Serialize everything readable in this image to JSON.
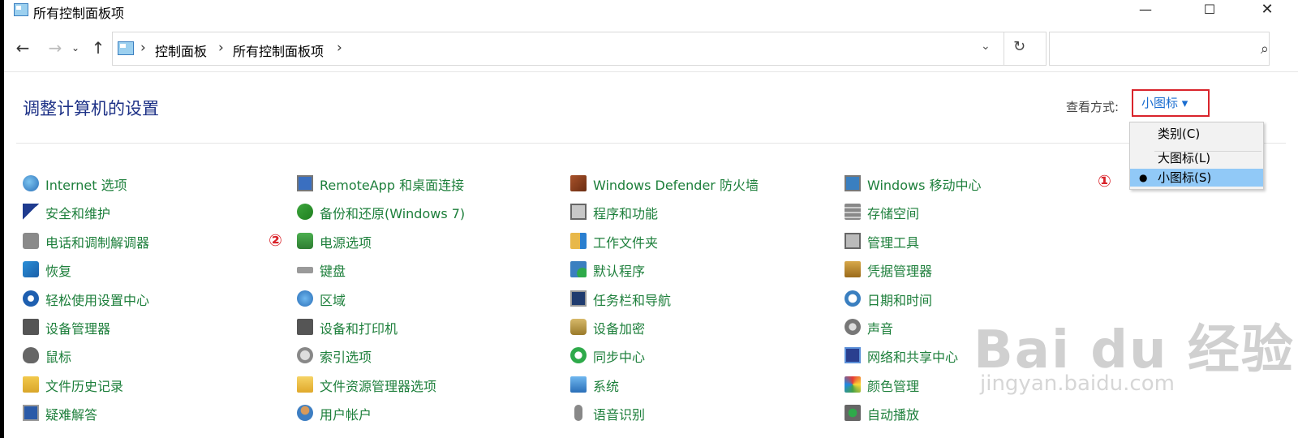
{
  "window": {
    "title": "所有控制面板项",
    "minimize": "—",
    "maximize": "☐",
    "close": "✕"
  },
  "nav": {
    "back": "←",
    "forward": "→",
    "recent": "⌄",
    "up": "↑",
    "refresh": "↻",
    "dropdown": "⌄",
    "crumbs": [
      "控制面板",
      "所有控制面板项"
    ],
    "separator": "›",
    "search_value": "",
    "search_icon": "⌕"
  },
  "header": {
    "title": "调整计算机的设置",
    "viewby_label": "查看方式:",
    "viewby_value": "小图标 ▾"
  },
  "view_menu": {
    "items": [
      "类别(C)",
      "大图标(L)",
      "小图标(S)"
    ],
    "selected_marker": "●"
  },
  "annotations": [
    "①",
    "②"
  ],
  "colors": {
    "link_green": "#1d7f3b",
    "title_blue": "#1e3287",
    "accent_red": "#d9242b",
    "menu_highlight": "#91c9f7"
  },
  "columns": [
    [
      {
        "label": "Internet 选项",
        "icon": "globe-icon"
      },
      {
        "label": "安全和维护",
        "icon": "flag-icon"
      },
      {
        "label": "电话和调制解调器",
        "icon": "fax-icon"
      },
      {
        "label": "恢复",
        "icon": "recovery-icon"
      },
      {
        "label": "轻松使用设置中心",
        "icon": "ease-of-access-icon"
      },
      {
        "label": "设备管理器",
        "icon": "device-manager-icon"
      },
      {
        "label": "鼠标",
        "icon": "mouse-icon"
      },
      {
        "label": "文件历史记录",
        "icon": "file-history-icon"
      },
      {
        "label": "疑难解答",
        "icon": "troubleshoot-icon"
      }
    ],
    [
      {
        "label": "RemoteApp 和桌面连接",
        "icon": "remote-desktop-icon"
      },
      {
        "label": "备份和还原(Windows 7)",
        "icon": "backup-icon"
      },
      {
        "label": "电源选项",
        "icon": "power-icon"
      },
      {
        "label": "键盘",
        "icon": "keyboard-icon"
      },
      {
        "label": "区域",
        "icon": "region-icon"
      },
      {
        "label": "设备和打印机",
        "icon": "printer-icon"
      },
      {
        "label": "索引选项",
        "icon": "index-icon"
      },
      {
        "label": "文件资源管理器选项",
        "icon": "folder-options-icon"
      },
      {
        "label": "用户帐户",
        "icon": "user-accounts-icon"
      }
    ],
    [
      {
        "label": "Windows Defender 防火墙",
        "icon": "firewall-icon"
      },
      {
        "label": "程序和功能",
        "icon": "programs-icon"
      },
      {
        "label": "工作文件夹",
        "icon": "work-folders-icon"
      },
      {
        "label": "默认程序",
        "icon": "default-programs-icon"
      },
      {
        "label": "任务栏和导航",
        "icon": "taskbar-icon"
      },
      {
        "label": "设备加密",
        "icon": "encryption-icon"
      },
      {
        "label": "同步中心",
        "icon": "sync-icon"
      },
      {
        "label": "系统",
        "icon": "system-icon"
      },
      {
        "label": "语音识别",
        "icon": "microphone-icon"
      }
    ],
    [
      {
        "label": "Windows 移动中心",
        "icon": "mobility-center-icon"
      },
      {
        "label": "存储空间",
        "icon": "storage-icon"
      },
      {
        "label": "管理工具",
        "icon": "admin-tools-icon"
      },
      {
        "label": "凭据管理器",
        "icon": "credential-icon"
      },
      {
        "label": "日期和时间",
        "icon": "clock-icon"
      },
      {
        "label": "声音",
        "icon": "speaker-icon"
      },
      {
        "label": "网络和共享中心",
        "icon": "network-icon"
      },
      {
        "label": "颜色管理",
        "icon": "color-icon"
      },
      {
        "label": "自动播放",
        "icon": "autoplay-icon"
      }
    ]
  ],
  "watermark": {
    "text": "Bai du 经验",
    "sub": "jingyan.baidu.com"
  }
}
